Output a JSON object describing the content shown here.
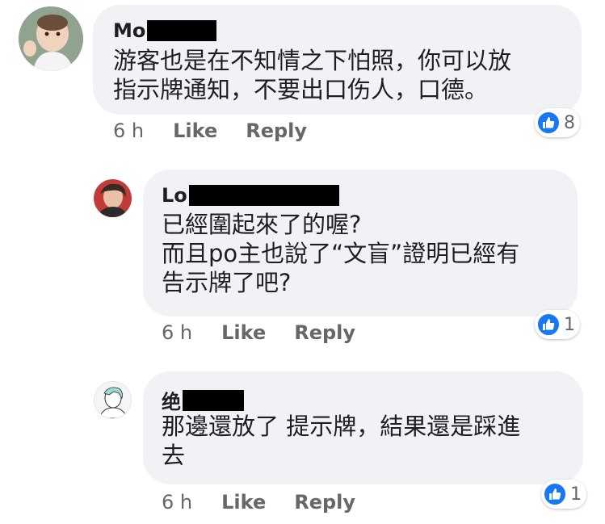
{
  "comments": [
    {
      "author_visible": "Mo",
      "text": "游客也是在不知情之下怕照，你可以放\n指示牌通知，不要出口伤人，口德。",
      "time": "6 h",
      "like_label": "Like",
      "reply_label": "Reply",
      "reaction_count": "8"
    },
    {
      "author_visible": "Lo",
      "text": "已經圍起來了的喔?\n而且po主也說了“文盲”證明已經有\n告示牌了吧?",
      "time": "6 h",
      "like_label": "Like",
      "reply_label": "Reply",
      "reaction_count": "1"
    },
    {
      "author_visible": "绝",
      "text": "那邊還放了 提示牌，結果還是踩進\n去",
      "time": "6 h",
      "like_label": "Like",
      "reply_label": "Reply",
      "reaction_count": "1"
    }
  ],
  "colors": {
    "bubble": "#f0f2f5",
    "like_blue": "#1877f2",
    "meta_gray": "#65676b"
  },
  "icons": {
    "reaction": "thumbs-up-icon"
  }
}
